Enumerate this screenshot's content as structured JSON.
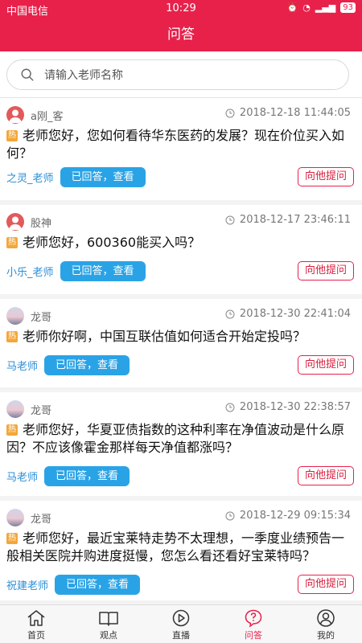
{
  "status": {
    "carrier": "中国电信",
    "time": "10:29",
    "battery": "93"
  },
  "nav": {
    "title": "问答"
  },
  "search": {
    "placeholder": "请输入老师名称"
  },
  "questions": [
    {
      "user": "a刚_客",
      "time": "2018-12-18 11:44:05",
      "hot": "热",
      "text": "老师您好，您如何看待华东医药的发展？现在价位买入如何？",
      "teacher": "之灵_老师",
      "answered": "已回答，查看",
      "ask": "向他提问"
    },
    {
      "user": "股神",
      "time": "2018-12-17 23:46:11",
      "hot": "热",
      "text": "老师您好，600360能买入吗？",
      "teacher": "小乐_老师",
      "answered": "已回答，查看",
      "ask": "向他提问"
    },
    {
      "user": "龙哥",
      "time": "2018-12-30 22:41:04",
      "hot": "热",
      "text": "老师你好啊，中国互联估值如何适合开始定投吗？",
      "teacher": "马老师",
      "answered": "已回答，查看",
      "ask": "向他提问"
    },
    {
      "user": "龙哥",
      "time": "2018-12-30 22:38:57",
      "hot": "热",
      "text": "老师您好，华夏亚债指数的这种利率在净值波动是什么原因？不应该像霍金那样每天净值都涨吗？",
      "teacher": "马老师",
      "answered": "已回答，查看",
      "ask": "向他提问"
    },
    {
      "user": "龙哥",
      "time": "2018-12-29 09:15:34",
      "hot": "热",
      "text": "老师您好，最近宝莱特走势不太理想，一季度业绩预告一般相关医院并购进度挺慢，您怎么看还看好宝莱特吗？",
      "teacher": "祝建老师",
      "answered": "已回答，查看",
      "ask": "向他提问"
    }
  ],
  "tabs": [
    {
      "label": "首页",
      "icon": "home-icon"
    },
    {
      "label": "观点",
      "icon": "book-icon"
    },
    {
      "label": "直播",
      "icon": "play-icon"
    },
    {
      "label": "问答",
      "icon": "question-icon"
    },
    {
      "label": "我的",
      "icon": "user-icon"
    }
  ],
  "colors": {
    "brand": "#e8214b",
    "answered": "#2aa3e6",
    "hot": "#f3a73a",
    "teacher": "#2a8dd6"
  }
}
